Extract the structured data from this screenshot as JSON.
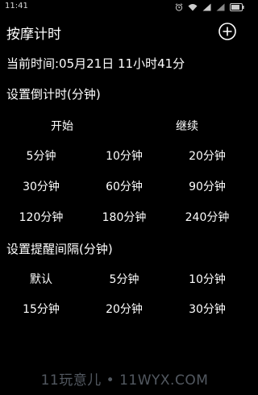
{
  "status_bar": {
    "time": "11:41",
    "icons": [
      "alarm-icon",
      "wifi-icon",
      "signal-icon",
      "signal-icon",
      "battery-icon"
    ]
  },
  "header": {
    "title": "按摩计时",
    "add_icon": "plus-circle-icon"
  },
  "current_time": "当前时间:05月21日 11小时41分",
  "countdown": {
    "heading": "设置倒计时(分钟)",
    "start_label": "开始",
    "continue_label": "继续",
    "options": [
      "5分钟",
      "10分钟",
      "20分钟",
      "30分钟",
      "60分钟",
      "90分钟",
      "120分钟",
      "180分钟",
      "240分钟"
    ]
  },
  "reminder": {
    "heading": "设置提醒间隔(分钟)",
    "options": [
      "默认",
      "5分钟",
      "10分钟",
      "15分钟",
      "20分钟",
      "30分钟"
    ]
  },
  "watermark": "11玩意儿 • 11WYX.COM"
}
